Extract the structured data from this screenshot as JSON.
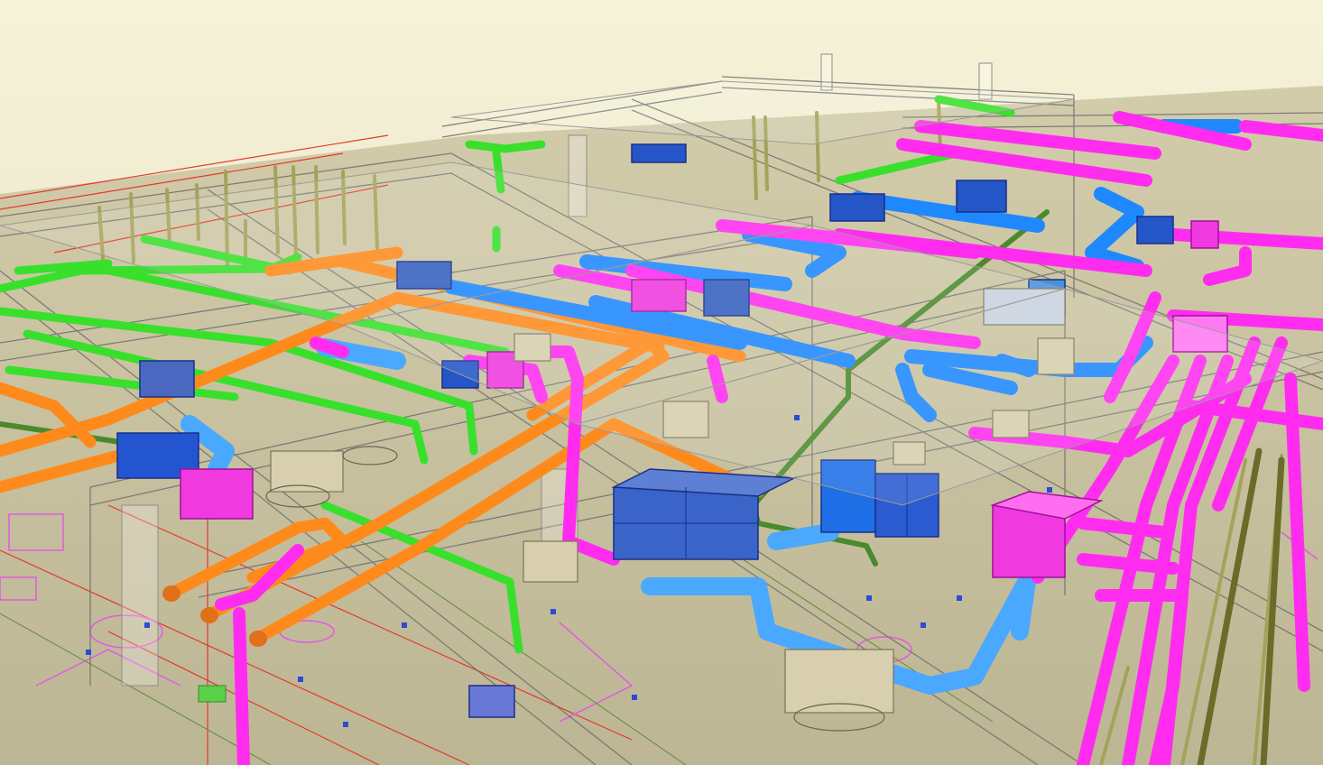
{
  "viewport": {
    "background_top": "#f5f1d6",
    "background_bottom": "#ded8b6",
    "floor_color": "#c7c19b"
  },
  "systems": [
    {
      "name": "supply-air-duct",
      "color": "#1e88ff"
    },
    {
      "name": "return-air-duct",
      "color": "#ff2cf0"
    },
    {
      "name": "chilled-water-pipe",
      "color": "#2fe32b"
    },
    {
      "name": "hot-water-pipe",
      "color": "#ff8a1c"
    },
    {
      "name": "condensate-pipe",
      "color": "#5a9a2c"
    },
    {
      "name": "drain-pipe",
      "color": "#8a8a30"
    },
    {
      "name": "fan-coil-unit",
      "color": "#2f5ad8"
    },
    {
      "name": "structure-frame",
      "color": "#7a7a7a"
    }
  ]
}
